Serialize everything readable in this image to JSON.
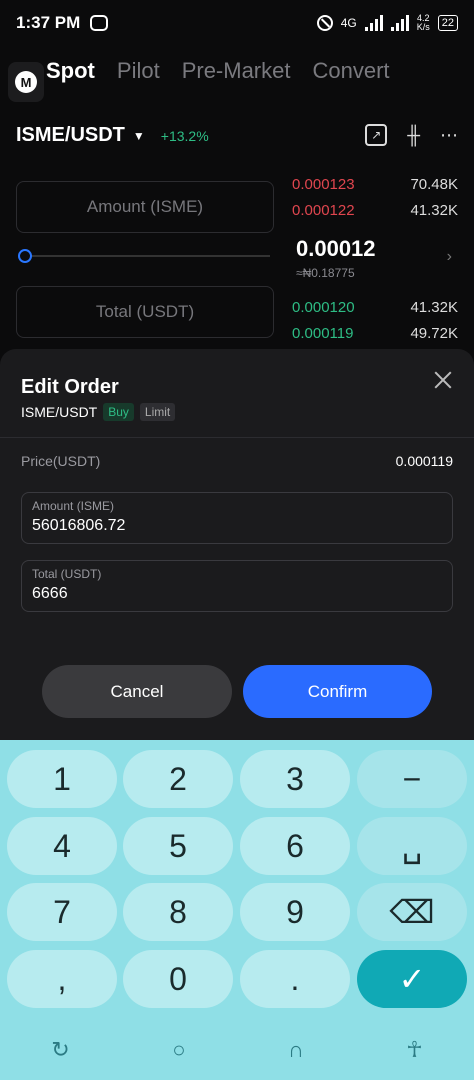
{
  "status": {
    "time": "1:37 PM",
    "net_speed": "4.2",
    "net_unit": "K/s",
    "net_type": "4G",
    "battery": "22"
  },
  "nav": {
    "logo": "M",
    "tabs": [
      "Spot",
      "Pilot",
      "Pre-Market",
      "Convert"
    ]
  },
  "pair": {
    "name": "ISME/USDT",
    "change": "+13.2%"
  },
  "form": {
    "amount_placeholder": "Amount (ISME)",
    "total_placeholder": "Total (USDT)"
  },
  "orderbook": {
    "asks": [
      {
        "price": "0.000123",
        "qty": "70.48K"
      },
      {
        "price": "0.000122",
        "qty": "41.32K"
      }
    ],
    "last_price": "0.00012",
    "last_price_fiat": "≈₦0.18775",
    "bids": [
      {
        "price": "0.000120",
        "qty": "41.32K"
      },
      {
        "price": "0.000119",
        "qty": "49.72K"
      }
    ]
  },
  "modal": {
    "title": "Edit Order",
    "pair": "ISME/USDT",
    "side": "Buy",
    "type": "Limit",
    "price_label": "Price(USDT)",
    "price_value": "0.000119",
    "amount_label": "Amount (ISME)",
    "amount_value": "56016806.72",
    "total_label": "Total (USDT)",
    "total_value": "6666",
    "cancel": "Cancel",
    "confirm": "Confirm"
  },
  "keyboard": {
    "keys": [
      "1",
      "2",
      "3",
      "−",
      "4",
      "5",
      "6",
      "␣",
      "7",
      "8",
      "9",
      "⌫",
      ",",
      "0",
      ".",
      "✓"
    ]
  },
  "colors": {
    "accent": "#2a6bff",
    "up": "#2ebd85",
    "down": "#e0464f",
    "keyboard": "#8fdfe6"
  }
}
